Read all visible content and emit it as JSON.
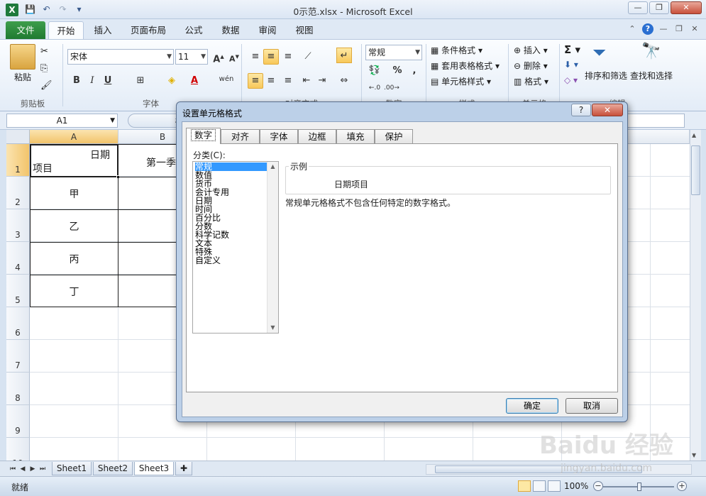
{
  "window": {
    "title": "0示范.xlsx - Microsoft Excel",
    "app_icon": "X"
  },
  "ribbon_tabs": [
    "文件",
    "开始",
    "插入",
    "页面布局",
    "公式",
    "数据",
    "审阅",
    "视图"
  ],
  "active_tab": "开始",
  "clipboard": {
    "paste_label": "粘贴",
    "group_label": "剪贴板"
  },
  "font": {
    "name": "宋体",
    "size": "11",
    "group_label": "字体"
  },
  "alignment": {
    "group_label": "对齐方式"
  },
  "number": {
    "format": "常规",
    "group_label": "数字"
  },
  "styles": {
    "conditional": "条件格式",
    "table_format": "套用表格格式",
    "cell_styles": "单元格样式",
    "group_label": "样式"
  },
  "cells_group": {
    "insert": "插入",
    "delete": "删除",
    "format": "格式",
    "group_label": "单元格"
  },
  "editing": {
    "sort_filter": "排序和筛选",
    "find_select": "查找和选择",
    "group_label": "编辑"
  },
  "formula_bar": {
    "name_box": "A1",
    "fx": "fx"
  },
  "columns": [
    "A",
    "B"
  ],
  "rows": [
    "1",
    "2",
    "3",
    "4",
    "5",
    "6",
    "7",
    "8",
    "9",
    "10"
  ],
  "cells": {
    "a1_top": "日期",
    "a1_bottom": "项目",
    "b1": "第一季",
    "a2": "甲",
    "a3": "乙",
    "a4": "丙",
    "a5": "丁"
  },
  "sheets": [
    "Sheet1",
    "Sheet2",
    "Sheet3"
  ],
  "active_sheet": "Sheet3",
  "status": {
    "ready": "就绪",
    "zoom": "100%"
  },
  "dialog": {
    "title": "设置单元格格式",
    "help": "?",
    "tabs": [
      "数字",
      "对齐",
      "字体",
      "边框",
      "填充",
      "保护"
    ],
    "active_tab": "数字",
    "category_label": "分类(C):",
    "categories": [
      "常规",
      "数值",
      "货币",
      "会计专用",
      "日期",
      "时间",
      "百分比",
      "分数",
      "科学记数",
      "文本",
      "特殊",
      "自定义"
    ],
    "selected_category": "常规",
    "sample_label": "示例",
    "sample_value": "日期项目",
    "description": "常规单元格格式不包含任何特定的数字格式。",
    "ok": "确定",
    "cancel": "取消"
  },
  "watermark": {
    "main": "Baidu 经验",
    "sub": "jingyan.baidu.com"
  }
}
